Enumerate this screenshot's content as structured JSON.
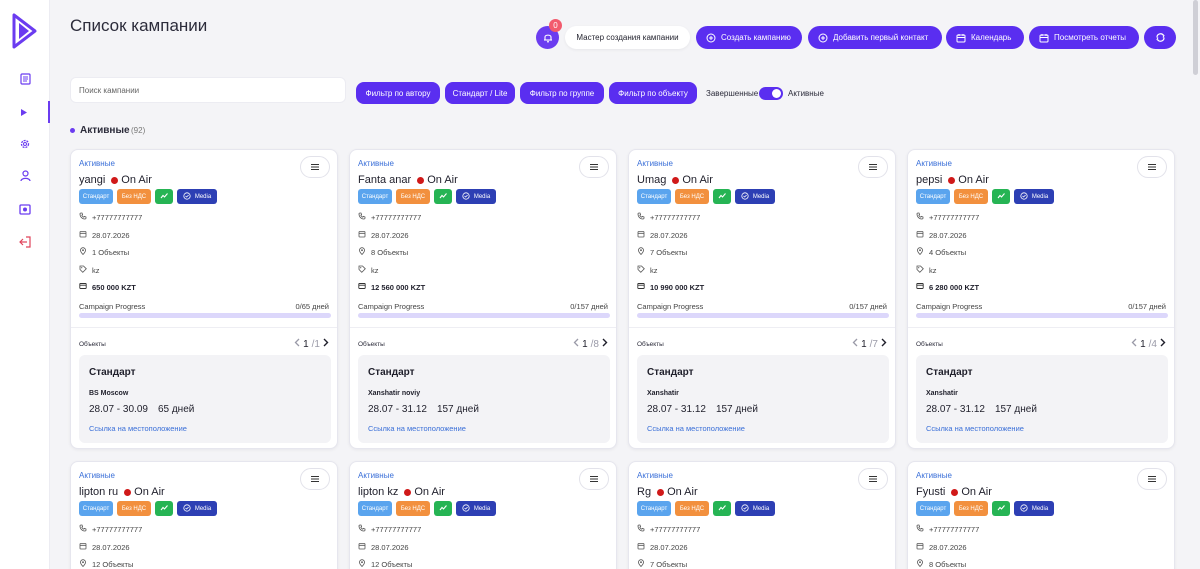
{
  "page": {
    "title": "Список кампании"
  },
  "notifications": {
    "count": "0"
  },
  "header_buttons": {
    "wizard": "Мастер создания кампании",
    "create": "Создать кампанию",
    "add_contact": "Добавить первый контакт",
    "calendar": "Календарь",
    "reports": "Посмотреть отчеты"
  },
  "filters": {
    "search_placeholder": "Поиск кампании",
    "by_author": "Фильтр по автору",
    "standard_lite": "Стандарт / Lite",
    "by_group": "Фильтр по группе",
    "by_object": "Фильтр по объекту",
    "completed_label": "Завершенные",
    "active_label": "Активные"
  },
  "section": {
    "title": "Активные",
    "count": "(92)"
  },
  "card_labels": {
    "status": "Активные",
    "on_air": "On Air",
    "badge_standard": "Стандарт",
    "badge_vat": "Без НДС",
    "badge_media": "Media",
    "progress": "Campaign Progress",
    "objects": "Объекты",
    "location_link": "Ссылка на местоположение"
  },
  "campaigns": [
    {
      "name": "yangi",
      "phone": "+77777777777",
      "date": "28.07.2026",
      "objects_count": "1 Объекты",
      "tag": "kz",
      "budget": "650 000 KZT",
      "progress_days": "0/65 дней",
      "progress": 0,
      "page_current": "1",
      "page_total": "/1",
      "object_type": "Стандарт",
      "object_name": "BS Moscow",
      "object_dates": "28.07 - 30.09",
      "object_days": "65 дней"
    },
    {
      "name": "Fanta anar",
      "phone": "+77777777777",
      "date": "28.07.2026",
      "objects_count": "8 Объекты",
      "tag": "kz",
      "budget": "12 560 000 KZT",
      "progress_days": "0/157 дней",
      "progress": 0,
      "page_current": "1",
      "page_total": "/8",
      "object_type": "Стандарт",
      "object_name": "Xanshatir noviy",
      "object_dates": "28.07 - 31.12",
      "object_days": "157 дней"
    },
    {
      "name": "Umag",
      "phone": "+77777777777",
      "date": "28.07.2026",
      "objects_count": "7 Объекты",
      "tag": "kz",
      "budget": "10 990 000 KZT",
      "progress_days": "0/157 дней",
      "progress": 0,
      "page_current": "1",
      "page_total": "/7",
      "object_type": "Стандарт",
      "object_name": "Xanshatir",
      "object_dates": "28.07 - 31.12",
      "object_days": "157 дней"
    },
    {
      "name": "pepsi",
      "phone": "+77777777777",
      "date": "28.07.2026",
      "objects_count": "4 Объекты",
      "tag": "kz",
      "budget": "6 280 000 KZT",
      "progress_days": "0/157 дней",
      "progress": 0,
      "page_current": "1",
      "page_total": "/4",
      "object_type": "Стандарт",
      "object_name": "Xanshatir",
      "object_dates": "28.07 - 31.12",
      "object_days": "157 дней"
    },
    {
      "name": "lipton ru",
      "phone": "+77777777777",
      "date": "28.07.2026",
      "objects_count": "12 Объекты"
    },
    {
      "name": "lipton kz",
      "phone": "+77777777777",
      "date": "28.07.2026",
      "objects_count": "12 Объекты"
    },
    {
      "name": "Rg",
      "phone": "+77777777777",
      "date": "28.07.2026",
      "objects_count": "7 Объекты"
    },
    {
      "name": "Fyusti",
      "phone": "+77777777777",
      "date": "28.07.2026",
      "objects_count": "8 Объекты"
    }
  ],
  "colors": {
    "accent": "#5a2ef0",
    "status_blue": "#3a6fd8",
    "on_air_red": "#d01919",
    "badge_standard": "#5aa4ee",
    "badge_vat": "#f2903e",
    "badge_ok": "#26b454",
    "badge_media": "#2d3fb4"
  }
}
